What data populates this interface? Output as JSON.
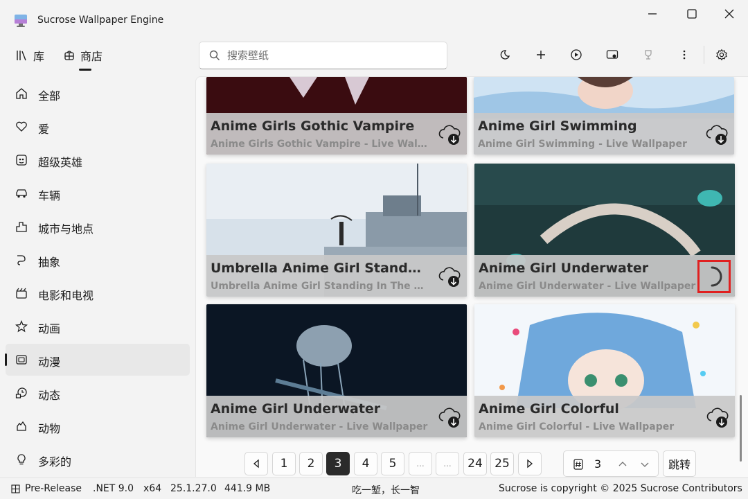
{
  "window": {
    "title": "Sucrose Wallpaper Engine",
    "minimize_icon": "minimize-icon",
    "maximize_icon": "maximize-icon",
    "close_icon": "close-icon"
  },
  "nav": {
    "tabs": [
      {
        "label": "库",
        "icon": "library-icon"
      },
      {
        "label": "商店",
        "icon": "store-icon",
        "selected": true
      }
    ]
  },
  "search": {
    "placeholder": "搜索壁纸",
    "value": ""
  },
  "toolbar": {
    "buttons": [
      "theme-moon-icon",
      "add-icon",
      "play-icon",
      "display-icon",
      "trophy-icon",
      "more-icon",
      "settings-icon"
    ]
  },
  "sidebar": {
    "items": [
      {
        "label": "全部",
        "icon": "home-icon"
      },
      {
        "label": "爱",
        "icon": "heart-icon"
      },
      {
        "label": "超级英雄",
        "icon": "hero-icon"
      },
      {
        "label": "车辆",
        "icon": "car-icon"
      },
      {
        "label": "城市与地点",
        "icon": "city-icon"
      },
      {
        "label": "抽象",
        "icon": "abstract-icon"
      },
      {
        "label": "电影和电视",
        "icon": "movie-icon"
      },
      {
        "label": "动画",
        "icon": "star-icon"
      },
      {
        "label": "动漫",
        "icon": "anime-icon",
        "selected": true
      },
      {
        "label": "动态",
        "icon": "dynamic-icon"
      },
      {
        "label": "动物",
        "icon": "animal-icon"
      },
      {
        "label": "多彩的",
        "icon": "bulb-icon"
      }
    ]
  },
  "cards": [
    {
      "title": "Anime Girls Gothic Vampire",
      "subtitle": "Anime Girls Gothic Vampire - Live Wallpa...",
      "action": "download-icon"
    },
    {
      "title": "Anime Girl Swimming",
      "subtitle": "Anime Girl Swimming - Live Wallpaper",
      "action": "download-icon"
    },
    {
      "title": "Umbrella Anime Girl Standing...",
      "subtitle": "Umbrella Anime Girl Standing In The Rai...",
      "action": "download-icon"
    },
    {
      "title": "Anime Girl Underwater",
      "subtitle": "Anime Girl Underwater - Live Wallpaper",
      "action": "loading-spinner-icon"
    },
    {
      "title": "Anime Girl Underwater",
      "subtitle": "Anime Girl Underwater - Live Wallpaper",
      "action": "download-icon"
    },
    {
      "title": "Anime Girl Colorful",
      "subtitle": "Anime Girl Colorful - Live Wallpaper",
      "action": "download-icon"
    }
  ],
  "pagination": {
    "prev_icon": "chevron-left-icon",
    "next_icon": "chevron-right-icon",
    "pages": [
      "1",
      "2",
      "3",
      "4",
      "5",
      "...",
      "...",
      "24",
      "25"
    ],
    "current": "3",
    "jump_value": "3",
    "jump_label": "跳转"
  },
  "status": {
    "release": "Pre-Release",
    "runtime": ".NET 9.0",
    "arch": "x64",
    "version": "25.1.27.0",
    "memory": "441.9 MB",
    "motto": "吃一堑，长一智",
    "copyright": "Sucrose is copyright © 2025 Sucrose Contributors"
  },
  "colors": {
    "accent": "#2b2b2b",
    "highlight": "#e02020",
    "background": "#f3f3f3"
  }
}
